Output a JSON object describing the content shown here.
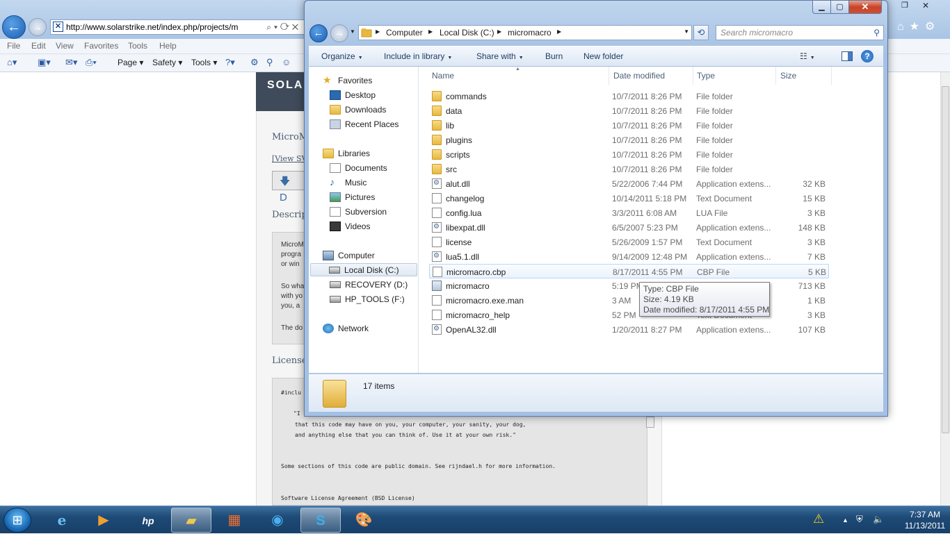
{
  "ie": {
    "url": "http://www.solarstrike.net/index.php/projects/m",
    "menu": [
      "File",
      "Edit",
      "View",
      "Favorites",
      "Tools",
      "Help"
    ],
    "commands": {
      "page": "Page",
      "safety": "Safety",
      "tools": "Tools"
    },
    "page": {
      "header_text": "SOLA",
      "title_fragment": "MicroM",
      "view_link": "[View SV",
      "download_label": "D",
      "description_heading": "Descript",
      "desc_lines": [
        "MicroM",
        "progra",
        "or win",
        "So wha",
        "with yo",
        "you, a",
        "The do"
      ],
      "license_heading": "License",
      "code_lines": [
        "#inclu",
        "\"I",
        "that this code may have on you, your computer, your sanity, your dog,",
        "and anything else that you can think of. Use it at your own risk.\"",
        "Some sections of this code are public domain. See rijndael.h for more information.",
        "Software License Agreement (BSD License)"
      ]
    }
  },
  "explorer": {
    "breadcrumb": [
      "Computer",
      "Local Disk (C:)",
      "micromacro"
    ],
    "search_placeholder": "Search micromacro",
    "toolbar": {
      "organize": "Organize",
      "include_in_library": "Include in library",
      "share_with": "Share with",
      "burn": "Burn",
      "new_folder": "New folder"
    },
    "nav": {
      "favorites": "Favorites",
      "desktop": "Desktop",
      "downloads": "Downloads",
      "recent_places": "Recent Places",
      "libraries": "Libraries",
      "documents": "Documents",
      "music": "Music",
      "pictures": "Pictures",
      "subversion": "Subversion",
      "videos": "Videos",
      "computer": "Computer",
      "local_disk": "Local Disk (C:)",
      "recovery": "RECOVERY (D:)",
      "hp_tools": "HP_TOOLS (F:)",
      "network": "Network"
    },
    "columns": {
      "name": "Name",
      "date_modified": "Date modified",
      "type": "Type",
      "size": "Size"
    },
    "files": [
      {
        "name": "commands",
        "date": "10/7/2011 8:26 PM",
        "type": "File folder",
        "size": "",
        "kind": "folder"
      },
      {
        "name": "data",
        "date": "10/7/2011 8:26 PM",
        "type": "File folder",
        "size": "",
        "kind": "folder"
      },
      {
        "name": "lib",
        "date": "10/7/2011 8:26 PM",
        "type": "File folder",
        "size": "",
        "kind": "folder"
      },
      {
        "name": "plugins",
        "date": "10/7/2011 8:26 PM",
        "type": "File folder",
        "size": "",
        "kind": "folder"
      },
      {
        "name": "scripts",
        "date": "10/7/2011 8:26 PM",
        "type": "File folder",
        "size": "",
        "kind": "folder"
      },
      {
        "name": "src",
        "date": "10/7/2011 8:26 PM",
        "type": "File folder",
        "size": "",
        "kind": "folder"
      },
      {
        "name": "alut.dll",
        "date": "5/22/2006 7:44 PM",
        "type": "Application extens...",
        "size": "32 KB",
        "kind": "dll"
      },
      {
        "name": "changelog",
        "date": "10/14/2011 5:18 PM",
        "type": "Text Document",
        "size": "15 KB",
        "kind": "doc"
      },
      {
        "name": "config.lua",
        "date": "3/3/2011 6:08 AM",
        "type": "LUA File",
        "size": "3 KB",
        "kind": "doc"
      },
      {
        "name": "libexpat.dll",
        "date": "6/5/2007 5:23 PM",
        "type": "Application extens...",
        "size": "148 KB",
        "kind": "dll"
      },
      {
        "name": "license",
        "date": "5/26/2009 1:57 PM",
        "type": "Text Document",
        "size": "3 KB",
        "kind": "doc"
      },
      {
        "name": "lua5.1.dll",
        "date": "9/14/2009 12:48 PM",
        "type": "Application extens...",
        "size": "7 KB",
        "kind": "dll"
      },
      {
        "name": "micromacro.cbp",
        "date": "8/17/2011 4:55 PM",
        "type": "CBP File",
        "size": "5 KB",
        "kind": "doc"
      },
      {
        "name": "micromacro",
        "date": "5:19 PM",
        "type": "Application",
        "size": "713 KB",
        "kind": "app"
      },
      {
        "name": "micromacro.exe.man",
        "date": "3 AM",
        "type": "MANIFEST File",
        "size": "1 KB",
        "kind": "doc"
      },
      {
        "name": "micromacro_help",
        "date": "52 PM",
        "type": "Text Document",
        "size": "3 KB",
        "kind": "doc"
      },
      {
        "name": "OpenAL32.dll",
        "date": "1/20/2011 8:27 PM",
        "type": "Application extens...",
        "size": "107 KB",
        "kind": "dll"
      }
    ],
    "tooltip": {
      "type": "Type: CBP File",
      "size": "Size: 4.19 KB",
      "date": "Date modified: 8/17/2011 4:55 PM"
    },
    "status": "17 items"
  },
  "taskbar": {
    "time": "7:37 AM",
    "date": "11/13/2011"
  },
  "colors": {
    "accent": "#1b5fb4",
    "taskbar": "#1e4a76",
    "folder": "#e8b83e"
  }
}
